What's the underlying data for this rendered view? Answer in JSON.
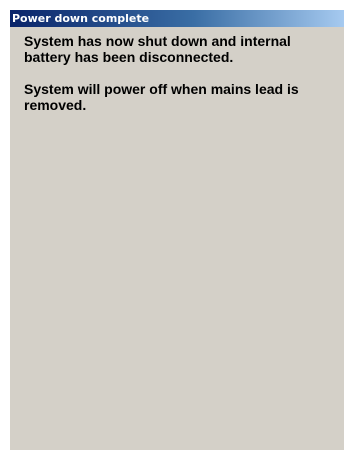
{
  "dialog": {
    "title": "Power down complete",
    "message_1": "System has now shut down and internal battery has been disconnected.",
    "message_2": "System will power off when mains lead is removed."
  },
  "colors": {
    "titlebar_start": "#0a246a",
    "titlebar_end": "#a6caf0",
    "window_background": "#d4d0c8"
  }
}
